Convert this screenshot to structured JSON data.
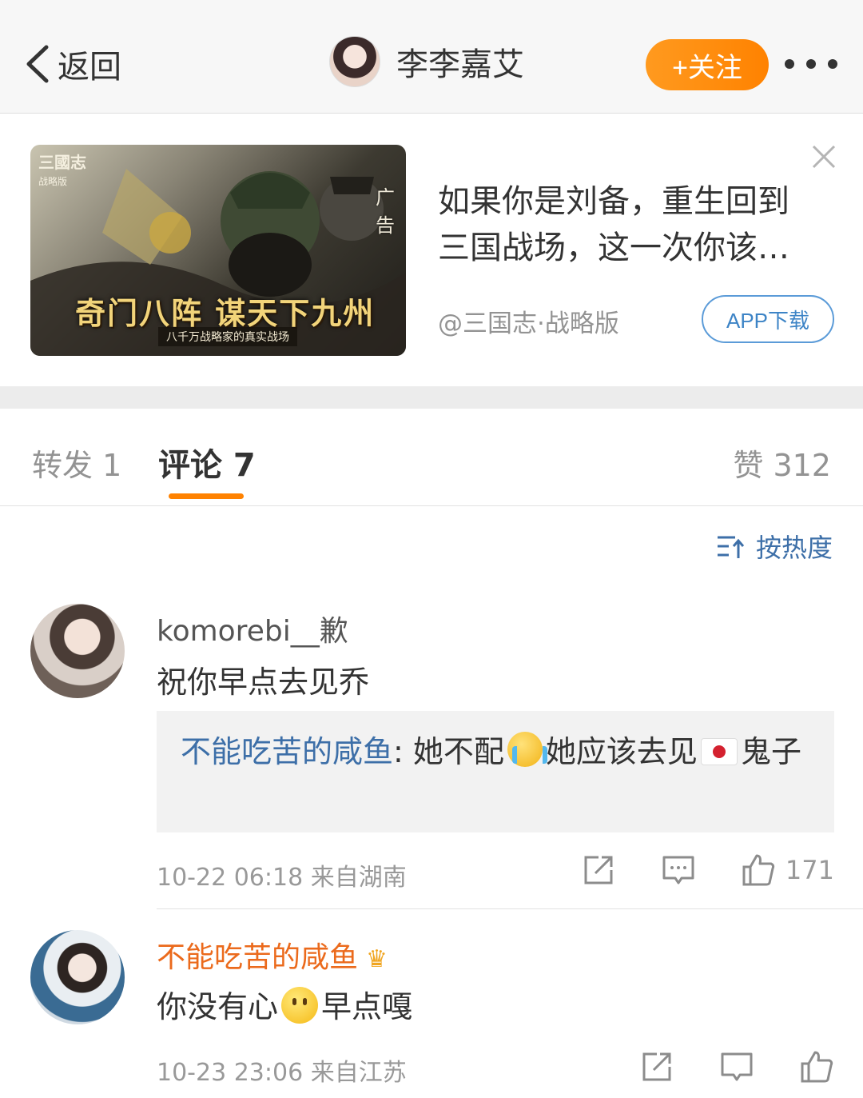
{
  "nav": {
    "back_label": "返回",
    "author_name": "李李嘉艾",
    "follow_label": "+关注"
  },
  "ad": {
    "badge": "广告",
    "logo": "三國志",
    "logo_sub": "战略版",
    "slogan": "奇门八阵 谋天下九州",
    "sub_slogan": "八千万战略家的真实战场",
    "title": "如果你是刘备，重生回到三国战场，这一次你该…",
    "source": "@三国志·战略版",
    "download_label": "APP下载"
  },
  "tabs": {
    "repost": "转发 1",
    "comment": "评论 7",
    "likes": "赞 312"
  },
  "sort": {
    "label": "按热度"
  },
  "comments": [
    {
      "user": "komorebi__歉",
      "text": "祝你早点去见乔",
      "reply": {
        "user": "不能吃苦的咸鱼",
        "sep": ": ",
        "text_before": "她不配",
        "text_middle": "她应该去见",
        "text_after": "鬼子"
      },
      "meta": "10-22 06:18  来自湖南",
      "likes": "171"
    },
    {
      "user": "不能吃苦的咸鱼",
      "text_before": "你没有心",
      "text_after": "早点嘎",
      "meta": "10-23 23:06  来自江苏"
    }
  ],
  "colors": {
    "accent": "#ff8200",
    "link": "#3d6fa8",
    "vip_name": "#eb6a1c"
  }
}
